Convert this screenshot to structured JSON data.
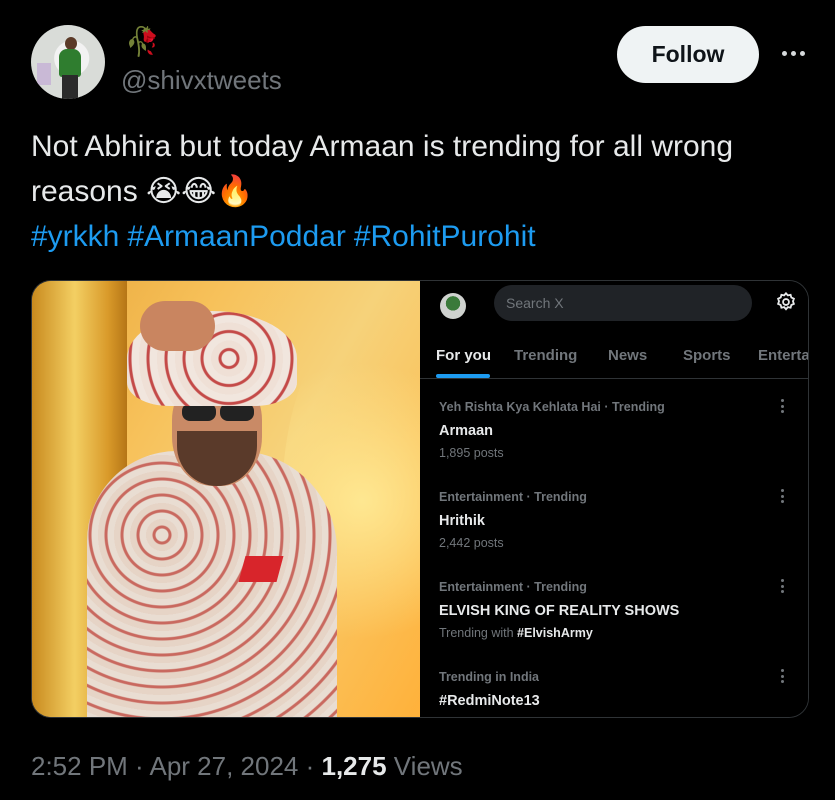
{
  "author": {
    "name_emoji": "🥀",
    "handle": "@shivxtweets"
  },
  "actions": {
    "follow_label": "Follow"
  },
  "tweet": {
    "text": "Not Abhira but today Armaan is trending for all wrong reasons 😭😂🔥",
    "hashtags": [
      "#yrkkh",
      "#ArmaanPoddar",
      "#RohitPurohit"
    ]
  },
  "embedded_screenshot": {
    "search_placeholder": "Search X",
    "tabs": [
      "For you",
      "Trending",
      "News",
      "Sports",
      "Enterta"
    ],
    "trends": [
      {
        "context": "Yeh Rishta Kya Kehlata Hai · Trending",
        "name": "Armaan",
        "meta": "1,895 posts"
      },
      {
        "context": "Entertainment · Trending",
        "name": "Hrithik",
        "meta": "2,442 posts"
      },
      {
        "context": "Entertainment · Trending",
        "name": "ELVISH KING OF REALITY SHOWS",
        "meta_prefix": "Trending with ",
        "meta_tag": "#ElvishArmy"
      },
      {
        "context": "Trending in India",
        "name": "#RedmiNote13"
      }
    ]
  },
  "footer": {
    "time": "2:52 PM",
    "sep1": " · ",
    "date": "Apr 27, 2024",
    "sep2": " · ",
    "views_count": "1,275",
    "views_label": " Views"
  },
  "colors": {
    "background": "#000000",
    "link": "#1d9bf0",
    "secondary_text": "#71767b",
    "follow_bg": "#eff3f4"
  }
}
